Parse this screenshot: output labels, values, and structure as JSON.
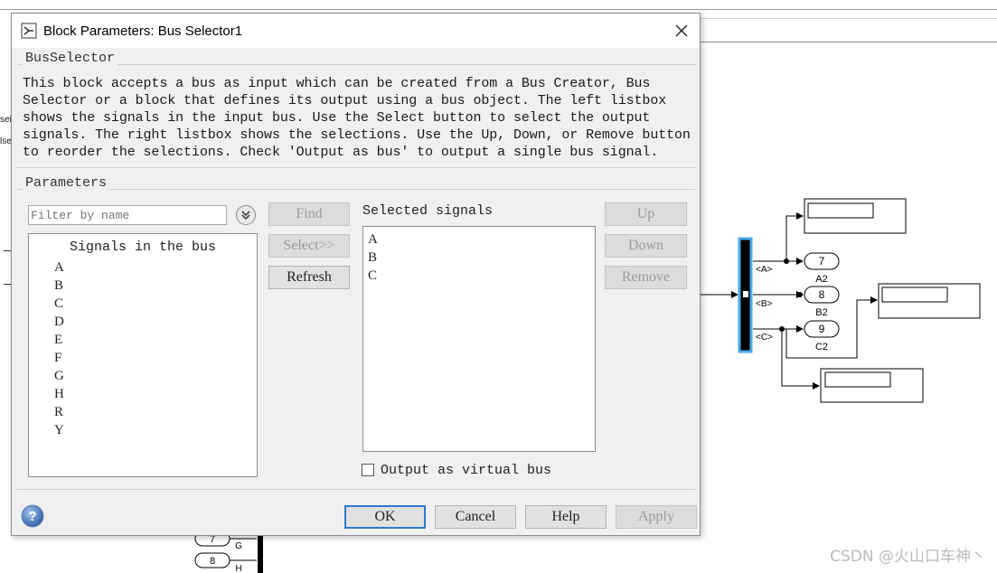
{
  "dialog": {
    "title": "Block Parameters: Bus Selector1",
    "block_type": "BusSelector",
    "description": "This block accepts a bus as input which can be created from a Bus Creator, Bus Selector or a block that defines its output using a bus object. The left listbox shows the signals in the input bus. Use the Select button to select the output signals. The right listbox shows the selections. Use the Up, Down, or Remove button to reorder the selections. Check 'Output as bus' to output a single bus signal.",
    "parameters_label": "Parameters",
    "filter_placeholder": "Filter by name",
    "find_label": "Find",
    "select_label": "Select>>",
    "refresh_label": "Refresh",
    "signals_header": "Signals in the bus",
    "signals": [
      "A",
      "B",
      "C",
      "D",
      "E",
      "F",
      "G",
      "H",
      "R",
      "Y"
    ],
    "selected_header": "Selected signals",
    "selected": [
      "A",
      "B",
      "C"
    ],
    "up_label": "Up",
    "down_label": "Down",
    "remove_label": "Remove",
    "checkbox_label": "Output as virtual bus",
    "checkbox_checked": false,
    "ok_label": "OK",
    "cancel_label": "Cancel",
    "help_label": "Help",
    "apply_label": "Apply"
  },
  "diagram": {
    "left_fragments": [
      "sei",
      "lse"
    ],
    "bus_labels": [
      "<A>",
      "<B>",
      "<C>"
    ],
    "ports": [
      {
        "number": "7",
        "name": "A2"
      },
      {
        "number": "8",
        "name": "B2"
      },
      {
        "number": "9",
        "name": "C2"
      }
    ],
    "bottom_ports": [
      {
        "number": "7",
        "name": "G"
      },
      {
        "number": "8",
        "name": "H"
      }
    ]
  },
  "watermark": "CSDN @火山口车神丶",
  "colors": {
    "accent": "#2b7bd0",
    "bus_highlight": "#4aa8e8",
    "dialog_bg": "#f0f0f0"
  }
}
